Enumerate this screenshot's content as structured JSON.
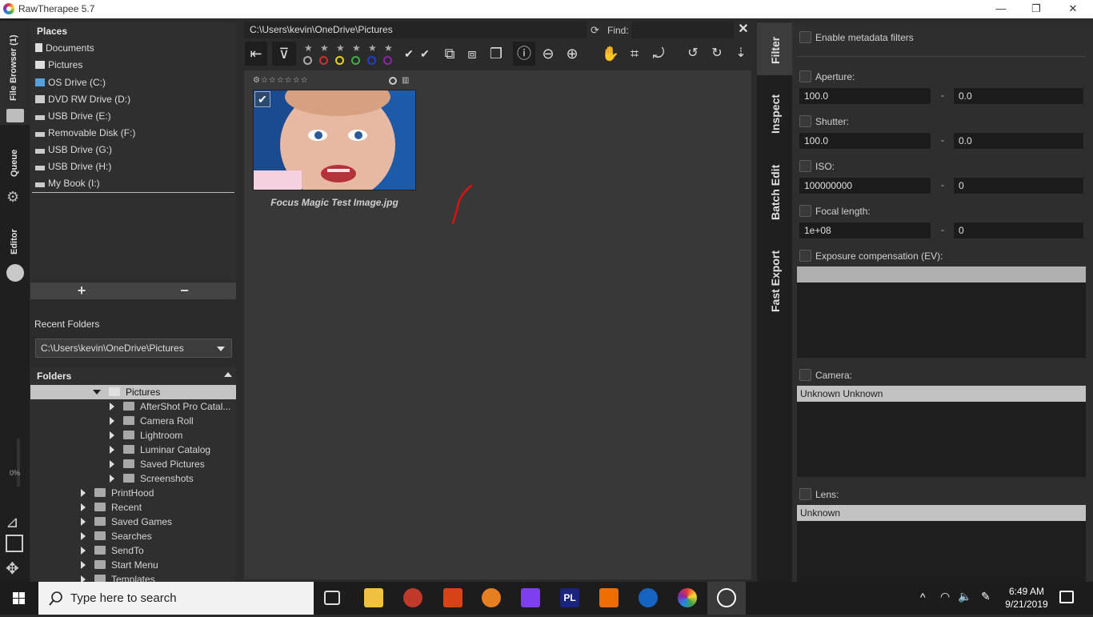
{
  "window": {
    "title": "RawTherapee 5.7"
  },
  "left_tabs": {
    "file_browser": "File Browser (1)",
    "queue": "Queue",
    "editor": "Editor",
    "progress": "0%"
  },
  "places": {
    "header": "Places",
    "items": [
      {
        "label": "Documents",
        "icon": "document-icon"
      },
      {
        "label": "Pictures",
        "icon": "camera-icon"
      },
      {
        "label": "OS Drive (C:)",
        "icon": "os-drive-icon"
      },
      {
        "label": "DVD RW Drive (D:)",
        "icon": "dvd-drive-icon"
      },
      {
        "label": "USB Drive (E:)",
        "icon": "usb-drive-icon"
      },
      {
        "label": "Removable Disk (F:)",
        "icon": "usb-drive-icon"
      },
      {
        "label": "USB Drive (G:)",
        "icon": "usb-drive-icon"
      },
      {
        "label": "USB Drive (H:)",
        "icon": "usb-drive-icon"
      },
      {
        "label": "My Book (I:)",
        "icon": "usb-drive-icon"
      }
    ],
    "add": "+",
    "remove": "−"
  },
  "recent_folders": {
    "header": "Recent Folders",
    "selected": "C:\\Users\\kevin\\OneDrive\\Pictures"
  },
  "folders": {
    "header": "Folders",
    "rows": [
      {
        "label": "Pictures",
        "depth": 2,
        "expanded": true,
        "selected": true
      },
      {
        "label": "AfterShot Pro Catal...",
        "depth": 3
      },
      {
        "label": "Camera Roll",
        "depth": 3
      },
      {
        "label": "Lightroom",
        "depth": 3
      },
      {
        "label": "Luminar Catalog",
        "depth": 3
      },
      {
        "label": "Saved Pictures",
        "depth": 3
      },
      {
        "label": "Screenshots",
        "depth": 3
      },
      {
        "label": "PrintHood",
        "depth": 1
      },
      {
        "label": "Recent",
        "depth": 1
      },
      {
        "label": "Saved Games",
        "depth": 1
      },
      {
        "label": "Searches",
        "depth": 1
      },
      {
        "label": "SendTo",
        "depth": 1
      },
      {
        "label": "Start Menu",
        "depth": 1
      },
      {
        "label": "Templates",
        "depth": 1
      }
    ]
  },
  "browser": {
    "path": "C:\\Users\\kevin\\OneDrive\\Pictures",
    "find_label": "Find:",
    "find_value": "",
    "thumbnail": {
      "caption": "Focus Magic Test Image.jpg",
      "rating": 0,
      "checked": true
    }
  },
  "right_tabs": {
    "filter": "Filter",
    "inspect": "Inspect",
    "batch_edit": "Batch Edit",
    "fast_export": "Fast Export"
  },
  "filter": {
    "enable_metadata": "Enable metadata filters",
    "aperture": {
      "label": "Aperture:",
      "from": "100.0",
      "to": "0.0"
    },
    "shutter": {
      "label": "Shutter:",
      "from": "100.0",
      "to": "0.0"
    },
    "iso": {
      "label": "ISO:",
      "from": "100000000",
      "to": "0"
    },
    "focal_length": {
      "label": "Focal length:",
      "from": "1e+08",
      "to": "0"
    },
    "exposure": {
      "label": "Exposure compensation (EV):"
    },
    "camera": {
      "label": "Camera:",
      "selected": "Unknown Unknown"
    },
    "lens": {
      "label": "Lens:",
      "selected": "Unknown"
    },
    "dash": "-"
  },
  "taskbar": {
    "search_placeholder": "Type here to search",
    "time": "6:49 AM",
    "date": "9/21/2019"
  }
}
